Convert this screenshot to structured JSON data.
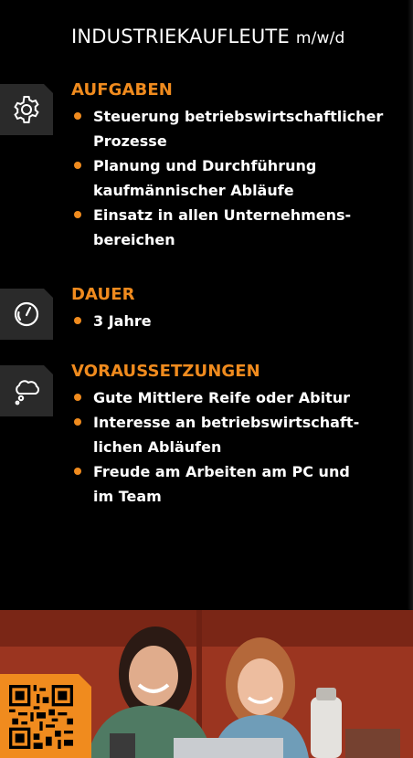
{
  "header": {
    "title": "INDUSTRIEKAUFLEUTE",
    "title_suffix": "m/w/d"
  },
  "sections": [
    {
      "icon": "gear-icon",
      "heading": "AUFGABEN",
      "items": [
        "Steuerung betriebswirtschaftlicher\nProzesse",
        "Planung und Durchführung\nkaufmännischer Abläufe",
        "Einsatz in allen Unternehmens-\nbereichen"
      ]
    },
    {
      "icon": "speedometer-icon",
      "heading": "DAUER",
      "items": [
        "3 Jahre"
      ]
    },
    {
      "icon": "thought-bubble-icon",
      "heading": "VORAUSSETZUNGEN",
      "items": [
        "Gute Mittlere Reife oder Abitur",
        "Interesse an betriebswirtschaft-\nlichen Abläufen",
        "Freude am Arbeiten am PC und\nim Team"
      ]
    }
  ],
  "colors": {
    "accent": "#f08b1e",
    "background": "#000000",
    "tab": "#2a2a2a"
  },
  "photo": {
    "subject": "two-smiling-young-women-at-laptop"
  },
  "qr": {
    "icon": "qr-code-icon"
  }
}
